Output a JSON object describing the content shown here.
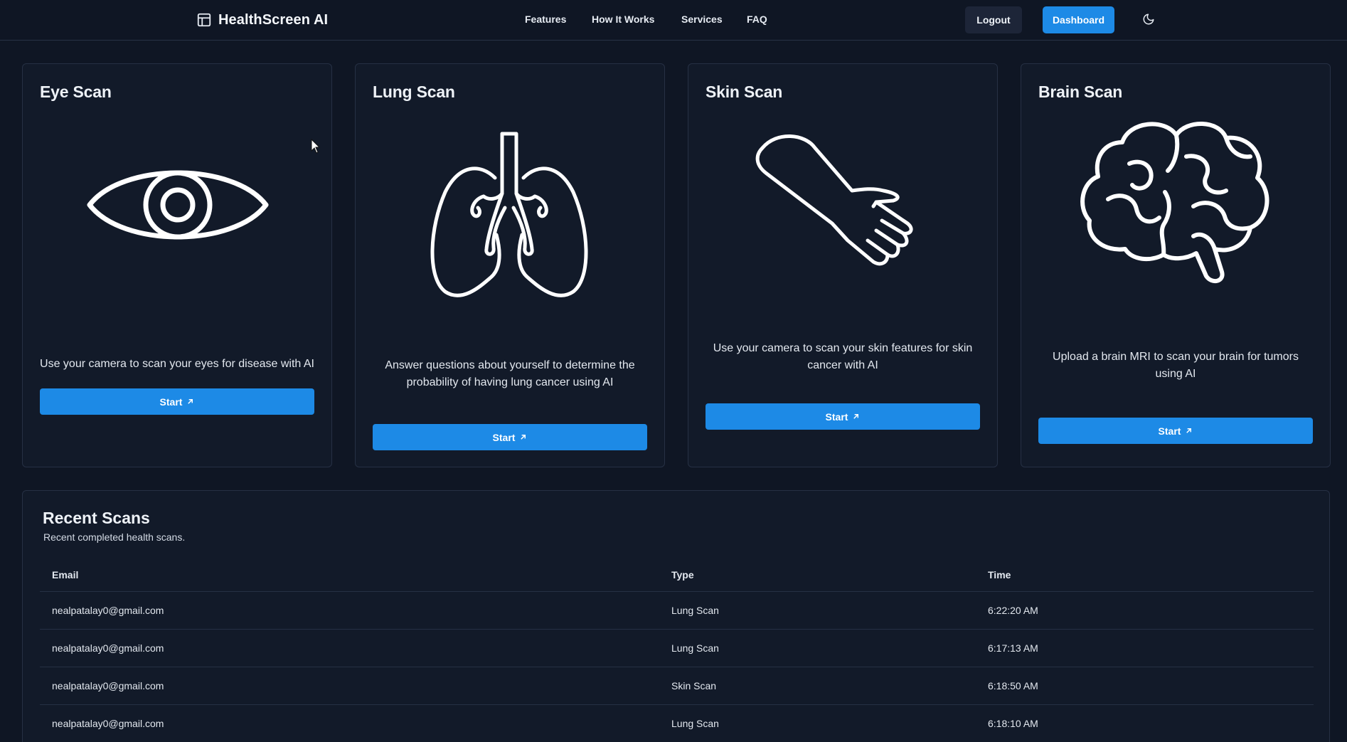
{
  "header": {
    "brand": "HealthScreen AI",
    "nav": [
      "Features",
      "How It Works",
      "Services",
      "FAQ"
    ],
    "logout_label": "Logout",
    "dashboard_label": "Dashboard",
    "theme_icon": "moon-icon"
  },
  "cards": [
    {
      "title": "Eye Scan",
      "description": "Use your camera to scan your eyes for disease with AI",
      "button": "Start",
      "icon": "eye-icon"
    },
    {
      "title": "Lung Scan",
      "description": "Answer questions about yourself to determine the probability of having lung cancer using AI",
      "button": "Start",
      "icon": "lungs-icon"
    },
    {
      "title": "Skin Scan",
      "description": "Use your camera to scan your skin features for skin cancer with AI",
      "button": "Start",
      "icon": "arm-icon"
    },
    {
      "title": "Brain Scan",
      "description": "Upload a brain MRI to scan your brain for tumors using AI",
      "button": "Start",
      "icon": "brain-icon"
    }
  ],
  "recent": {
    "title": "Recent Scans",
    "subtitle": "Recent completed health scans.",
    "columns": [
      "Email",
      "Type",
      "Time"
    ],
    "rows": [
      {
        "email": "nealpatalay0@gmail.com",
        "type": "Lung Scan",
        "time": "6:22:20 AM"
      },
      {
        "email": "nealpatalay0@gmail.com",
        "type": "Lung Scan",
        "time": "6:17:13 AM"
      },
      {
        "email": "nealpatalay0@gmail.com",
        "type": "Skin Scan",
        "time": "6:18:50 AM"
      },
      {
        "email": "nealpatalay0@gmail.com",
        "type": "Lung Scan",
        "time": "6:18:10 AM"
      }
    ]
  },
  "colors": {
    "background": "#0f1624",
    "card": "#121a29",
    "accent": "#1d8ae6",
    "border": "#263044"
  }
}
